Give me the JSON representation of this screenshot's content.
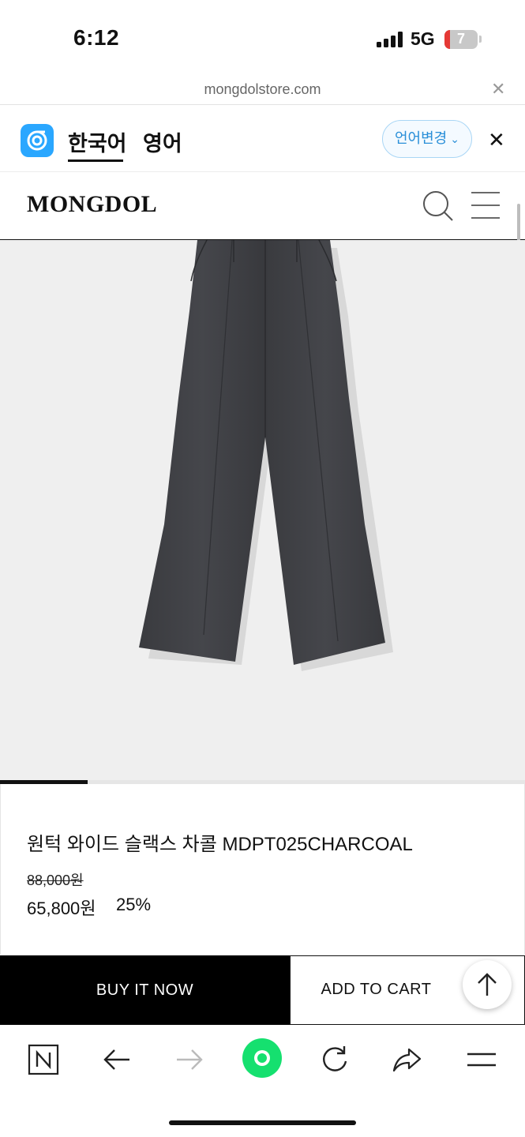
{
  "status_bar": {
    "time": "6:12",
    "network": "5G",
    "battery": "7"
  },
  "url_bar": {
    "domain": "mongdolstore.com"
  },
  "translate_bar": {
    "languages": [
      "한국어",
      "영어"
    ],
    "change_label": "언어변경"
  },
  "site": {
    "logo": "MONGDOL"
  },
  "gallery": {
    "progress": 0.167
  },
  "product": {
    "name": "원턱 와이드 슬랙스 차콜 MDPT025CHARCOAL",
    "original_price": "88,000원",
    "sale_price": "65,800원",
    "discount": "25%"
  },
  "actions": {
    "buy_now": "BUY IT NOW",
    "add_to_cart": "ADD TO CART"
  },
  "colors": {
    "translate_accent": "#2a8fd8",
    "home_button": "#15e06f",
    "buy_now_bg": "#000000"
  },
  "icons": [
    "papago-icon",
    "search-icon",
    "menu-icon",
    "close-icon",
    "arrow-up-icon",
    "naver-icon",
    "back-icon",
    "forward-icon",
    "home-icon",
    "reload-icon",
    "share-icon"
  ]
}
